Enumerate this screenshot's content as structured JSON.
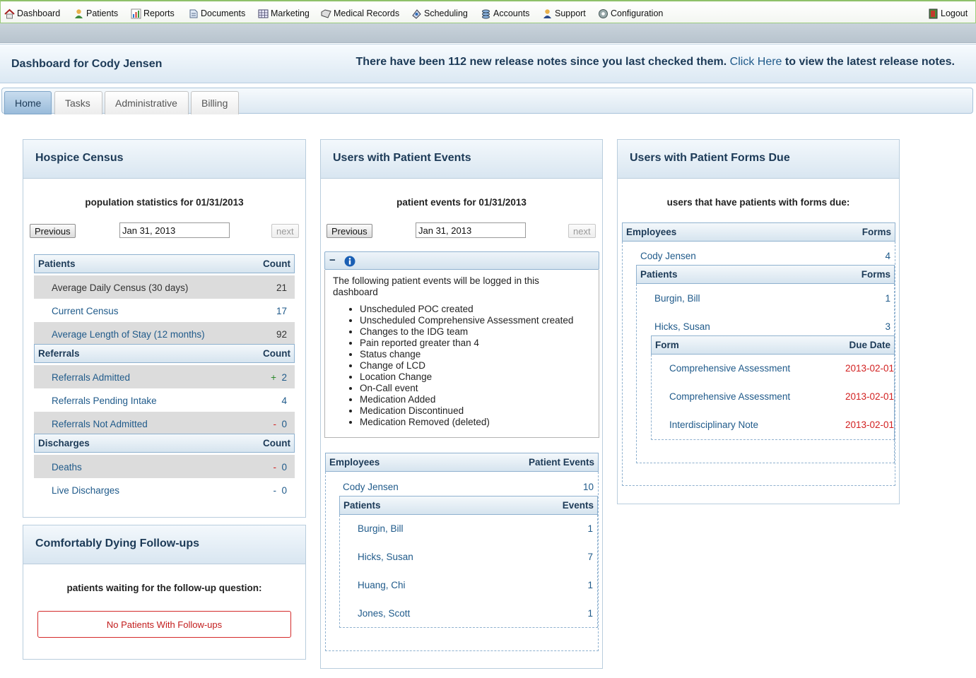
{
  "nav": {
    "items": [
      {
        "label": "Dashboard",
        "icon": "home-icon"
      },
      {
        "label": "Patients",
        "icon": "person-icon"
      },
      {
        "label": "Reports",
        "icon": "chart-icon"
      },
      {
        "label": "Documents",
        "icon": "document-icon"
      },
      {
        "label": "Marketing",
        "icon": "calendar-grid-icon"
      },
      {
        "label": "Medical Records",
        "icon": "folder-icon"
      },
      {
        "label": "Scheduling",
        "icon": "schedule-icon"
      },
      {
        "label": "Accounts",
        "icon": "accounts-icon"
      },
      {
        "label": "Support",
        "icon": "support-person-icon"
      },
      {
        "label": "Configuration",
        "icon": "gear-icon"
      }
    ],
    "logout": "Logout"
  },
  "header": {
    "title": "Dashboard for Cody Jensen",
    "notes_before": "There have been 112 new release notes since you last checked them.",
    "notes_link": "Click Here",
    "notes_after": "to view the latest release notes."
  },
  "tabs": [
    "Home",
    "Tasks",
    "Administrative",
    "Billing"
  ],
  "census": {
    "title": "Hospice Census",
    "subtitle": "population statistics for 01/31/2013",
    "prev": "Previous",
    "next": "next",
    "date": "Jan 31, 2013",
    "patients_header": {
      "label": "Patients",
      "count": "Count"
    },
    "patients_rows": [
      {
        "label": "Average Daily Census (30 days)",
        "value": "21"
      },
      {
        "label": "Current Census",
        "value": "17"
      },
      {
        "label": "Average Length of Stay (12 months)",
        "value": "92"
      }
    ],
    "referrals_header": {
      "label": "Referrals",
      "count": "Count"
    },
    "referrals_rows": [
      {
        "label": "Referrals Admitted",
        "sign": "+",
        "value": "2"
      },
      {
        "label": "Referrals Pending Intake",
        "sign": "",
        "value": "4"
      },
      {
        "label": "Referrals Not Admitted",
        "sign": "-",
        "value": "0"
      }
    ],
    "discharges_header": {
      "label": "Discharges",
      "count": "Count"
    },
    "discharges_rows": [
      {
        "label": "Deaths",
        "sign": "-",
        "value": "0"
      },
      {
        "label": "Live Discharges",
        "sign": "-",
        "value": "0"
      }
    ]
  },
  "followups": {
    "title": "Comfortably Dying Follow-ups",
    "subtitle": "patients waiting for the follow-up question:",
    "empty": "No Patients With Follow-ups"
  },
  "events": {
    "title": "Users with Patient Events",
    "subtitle": "patient events for 01/31/2013",
    "prev": "Previous",
    "next": "next",
    "date": "Jan 31, 2013",
    "info_toggle": "−",
    "info_text": "The following patient events will be logged in this dashboard",
    "info_items": [
      "Unscheduled POC created",
      "Unscheduled Comprehensive Assessment created",
      "Changes to the IDG team",
      "Pain reported greater than 4",
      "Status change",
      "Change of LCD",
      "Location Change",
      "On-Call event",
      "Medication Added",
      "Medication Discontinued",
      "Medication Removed (deleted)"
    ],
    "emp_header": {
      "label": "Employees",
      "count": "Patient Events"
    },
    "employee": {
      "name": "Cody Jensen",
      "count": "10"
    },
    "pat_header": {
      "label": "Patients",
      "count": "Events"
    },
    "patients": [
      {
        "name": "Burgin, Bill",
        "count": "1"
      },
      {
        "name": "Hicks, Susan",
        "count": "7"
      },
      {
        "name": "Huang, Chi",
        "count": "1"
      },
      {
        "name": "Jones, Scott",
        "count": "1"
      }
    ]
  },
  "forms": {
    "title": "Users with Patient Forms Due",
    "subtitle": "users that have patients with forms due:",
    "emp_header": {
      "label": "Employees",
      "count": "Forms"
    },
    "employee": {
      "name": "Cody Jensen",
      "count": "4"
    },
    "pat_header": {
      "label": "Patients",
      "count": "Forms"
    },
    "patients": [
      {
        "name": "Burgin, Bill",
        "count": "1"
      },
      {
        "name": "Hicks, Susan",
        "count": "3"
      }
    ],
    "form_header": {
      "label": "Form",
      "count": "Due Date"
    },
    "forms_list": [
      {
        "name": "Comprehensive Assessment",
        "due": "2013-02-01"
      },
      {
        "name": "Comprehensive Assessment",
        "due": "2013-02-01"
      },
      {
        "name": "Interdisciplinary Note",
        "due": "2013-02-01"
      }
    ]
  },
  "colors": {
    "link": "#1f5a8a",
    "header_text": "#1c3a57",
    "due_red": "#d22020",
    "positive_green": "#2c8a2c"
  }
}
